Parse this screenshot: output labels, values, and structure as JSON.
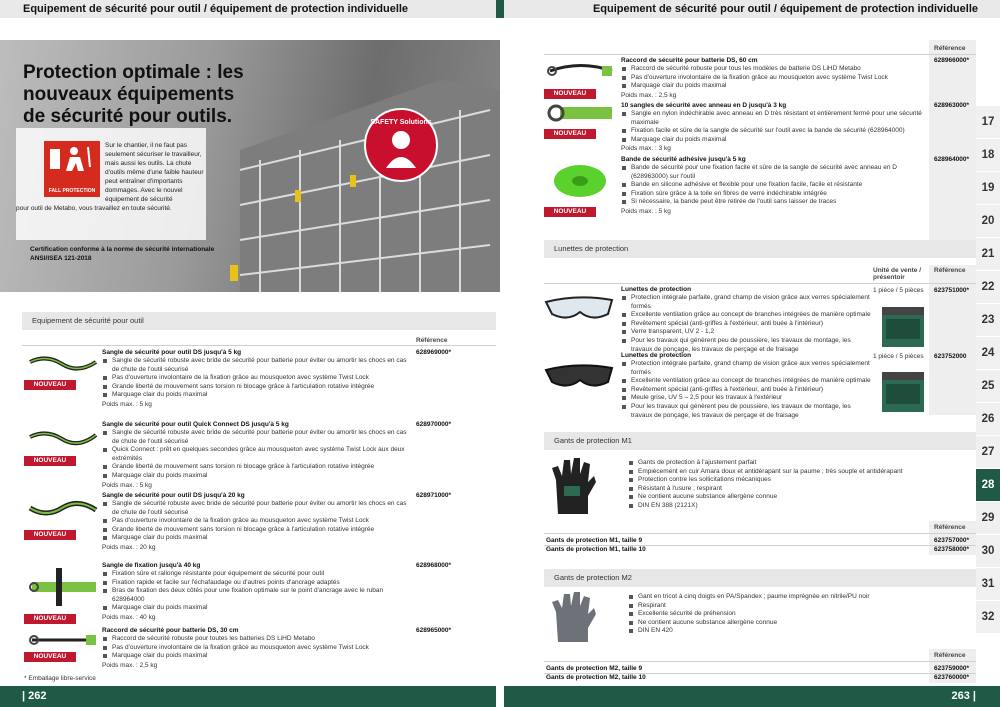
{
  "header": {
    "left": "Equipement de sécurité pour outil / équipement de protection individuelle",
    "right": "Equipement de sécurité pour outil / équipement de protection individuelle"
  },
  "footer": {
    "left": "| 262",
    "right": "263 |"
  },
  "hero": {
    "title": "Protection optimale : les nouveaux équipements de sécurité pour outils.",
    "badge_label": "FALL PROTECTION",
    "seal_text": "SAFETY Solutions",
    "body": "Sur le chantier, il ne faut pas seulement sécuriser le travailleur, mais aussi les outils. La chute d'outils même d'une faible hauteur peut entraîner d'importants dommages. Avec le nouvel équipement de sécurité",
    "body2": "pour outil de Metabo, vous travaillez en toute sécurité.",
    "cert": "Certification conforme à la norme de sécurité internationale ANSI/ISEA 121-2018"
  },
  "left_section": {
    "title": "Equipement de sécurité pour outil",
    "ref_header": "Référence",
    "new_label": "NOUVEAU",
    "products": [
      {
        "title": "Sangle de sécurité pour outil DS jusqu'à 5 kg",
        "ref": "628969000*",
        "bullets": [
          "Sangle de sécurité robuste avec bride de sécurité pour batterie pour éviter ou amortir les chocs en cas de chute de l'outil sécurisé",
          "Pas d'ouverture involontaire de la fixation grâce au mousqueton avec système Twist Lock",
          "Grande liberté de mouvement sans torsion ni blocage grâce à l'articulation rotative intégrée",
          "Marquage clair du poids maximal"
        ],
        "pmax": "Poids max. : 5 kg"
      },
      {
        "title": "Sangle de sécurité pour outil Quick Connect DS jusqu'à 5 kg",
        "ref": "628970000*",
        "bullets": [
          "Sangle de sécurité robuste avec bride de sécurité pour batterie pour éviter ou amortir les chocs en cas de chute de l'outil sécurisé",
          "Quick Connect : prêt en quelques secondes grâce au mousqueton avec système Twist Lock aux deux extrémités",
          "Grande liberté de mouvement sans torsion ni blocage grâce à l'articulation rotative intégrée",
          "Marquage clair du poids maximal"
        ],
        "pmax": "Poids max. : 5 kg"
      },
      {
        "title": "Sangle de sécurité pour outil DS jusqu'à 20 kg",
        "ref": "628971000*",
        "bullets": [
          "Sangle de sécurité robuste avec bride de sécurité pour batterie pour éviter ou amortir les chocs en cas de chute de l'outil sécurisé",
          "Pas d'ouverture involontaire de la fixation grâce au mousqueton avec système Twist Lock",
          "Grande liberté de mouvement sans torsion ni blocage grâce à l'articulation rotative intégrée",
          "Marquage clair du poids maximal"
        ],
        "pmax": "Poids max. : 20 kg"
      },
      {
        "title": "Sangle de fixation jusqu'à 40 kg",
        "ref": "628968000*",
        "bullets": [
          "Fixation sûre et rallonge résistante pour équipement de sécurité pour outil",
          "Fixation rapide et facile sur l'échafaudage ou d'autres points d'ancrage adaptés",
          "Bras de fixation des deux côtés pour une fixation optimale sur le point d'ancrage avec le ruban 628964000",
          "Marquage clair du poids maximal"
        ],
        "pmax": "Poids max. : 40 kg"
      },
      {
        "title": "Raccord de sécurité pour batterie DS, 30 cm",
        "ref": "628965000*",
        "bullets": [
          "Raccord de sécurité robuste pour toutes les batteries DS LiHD Metabo",
          "Pas d'ouverture involontaire de la fixation grâce au mousqueton avec système Twist Lock",
          "Marquage clair du poids maximal"
        ],
        "pmax": "Poids max. : 2,5 kg"
      }
    ],
    "footnote": "* Emballage libre-service"
  },
  "right_top": {
    "ref_header": "Référence",
    "products": [
      {
        "title": "Raccord de sécurité pour batterie DS, 60 cm",
        "ref": "628966000*",
        "bullets": [
          "Raccord de sécurité robuste pour tous les modèles de batterie DS LiHD Metabo",
          "Pas d'ouverture involontaire de la fixation grâce au mousqueton avec système Twist Lock",
          "Marquage clair du poids maximal"
        ],
        "pmax": "Poids max. : 2,5 kg"
      },
      {
        "title": "10 sangles de sécurité avec anneau en D jusqu'à 3 kg",
        "ref": "628963000*",
        "bullets": [
          "Sangle en nylon indéchirable avec anneau en D très résistant et entièrement fermé pour une sécurité maximale",
          "Fixation facile et sûre de la sangle de sécurité sur l'outil avec la bande de sécurité (628964000)",
          "Marquage clair du poids maximal"
        ],
        "pmax": "Poids max. : 3 kg"
      },
      {
        "title": "Bande de sécurité adhésive jusqu'à 5 kg",
        "ref": "628964000*",
        "bullets": [
          "Bande de sécurité pour une fixation facile et sûre de la sangle de sécurité avec anneau en D (628963000) sur l'outil",
          "Bande en silicone adhésive et flexible pour une fixation facile, facile et résistante",
          "Fixation sûre grâce à la toile en fibres de verre indéchirable intégrée",
          "Si nécessaire, la bande peut être retirée de l'outil sans laisser de traces"
        ],
        "pmax": "Poids max. : 5 kg"
      }
    ]
  },
  "glasses": {
    "title": "Lunettes de protection",
    "unit_header": "Unité de vente / présentoir",
    "ref_header": "Référence",
    "products": [
      {
        "title": "Lunettes de protection",
        "unit": "1 pièce / 5 pièces",
        "ref": "623751000*",
        "bullets": [
          "Protection intégrale parfaite, grand champ de vision grâce aux verres spécialement formés",
          "Excellente ventilation grâce au concept de branches intégrées de manière optimale",
          "Revêtement spécial (anti-griffes à l'extérieur, anti buée à l'intérieur)",
          "Verre transparent, UV 2 - 1,2",
          "Pour les travaux qui génèrent peu de poussière, les travaux de montage, les travaux de ponçage, les travaux de perçage et de fraisage"
        ]
      },
      {
        "title": "Lunettes de protection",
        "unit": "1 pièce / 5 pièces",
        "ref": "623752000",
        "bullets": [
          "Protection intégrale parfaite, grand champ de vision grâce aux verres spécialement formés",
          "Excellente ventilation grâce au concept de branches intégrées de manière optimale",
          "Revêtement spécial (anti-griffes à l'extérieur, anti buée à l'intérieur)",
          "Meule grise, UV 5 – 2,5 pour les travaux à l'extérieur",
          "Pour les travaux qui génèrent peu de poussière, les travaux de montage, les travaux de ponçage, les travaux de perçage et de fraisage"
        ]
      }
    ]
  },
  "gloves_m1": {
    "title": "Gants de protection M1",
    "bullets": [
      "Gants de protection à l'ajustement parfait",
      "Empiècement en cuir Amara doux et antidérapant sur la paume ; très souple et antidérapant",
      "Protection contre les sollicitations mécaniques",
      "Résistant à l'usure ; respirant",
      "Ne contient aucune substance allergène connue",
      "DIN EN 388 (2121X)"
    ],
    "ref_header": "Référence",
    "rows": [
      {
        "label": "Gants de protection M1, taille 9",
        "ref": "623757000*"
      },
      {
        "label": "Gants de protection M1, taille 10",
        "ref": "623758000*"
      }
    ]
  },
  "gloves_m2": {
    "title": "Gants de protection M2",
    "bullets": [
      "Gant en tricot à cinq doigts en PA/Spandex ; paume imprégnée en nitrile/PU noir",
      "Respirant",
      "Excellente sécurité de préhension",
      "Ne contient aucune substance allergène connue",
      "DIN EN 420"
    ],
    "ref_header": "Référence",
    "rows": [
      {
        "label": "Gants de protection M2, taille 9",
        "ref": "623759000*"
      },
      {
        "label": "Gants de protection M2, taille 10",
        "ref": "623760000*"
      }
    ]
  },
  "tabs": [
    "17",
    "18",
    "19",
    "20",
    "21",
    "22",
    "23",
    "24",
    "25",
    "26",
    "27",
    "28",
    "29",
    "30",
    "31",
    "32"
  ],
  "active_tab": "28",
  "colors": {
    "brand_green": "#1f5a47",
    "new_red": "#c0182f",
    "fall_red": "#d52b1e"
  }
}
